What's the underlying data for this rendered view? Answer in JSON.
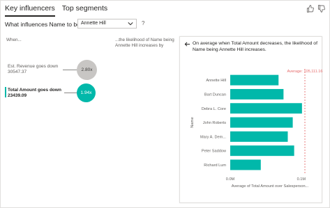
{
  "tabs": [
    {
      "label": "Key influencers",
      "active": true
    },
    {
      "label": "Top segments",
      "active": false
    }
  ],
  "question": {
    "label": "What influences Name to be",
    "selected_value": "Annette Hill",
    "help": "?"
  },
  "icons": {
    "thumbs_up": "thumbs-up-icon",
    "thumbs_down": "thumbs-down-icon",
    "back": "back-arrow-icon",
    "dropdown": "chevron-down-icon"
  },
  "headers": {
    "when": "When...",
    "likelihood": "...the likelihood of Name being Annette Hill increases by"
  },
  "influencers": [
    {
      "title": "Est. Revenue goes down",
      "value": "30547.37",
      "multiplier": "2.80x",
      "selected": false
    },
    {
      "title": "Total Amount goes down",
      "value": "23439.09",
      "multiplier": "1.94x",
      "selected": true
    }
  ],
  "panel": {
    "description": "On average when Total Amount decreases, the likelihood of Name being Annette Hill increases."
  },
  "colors": {
    "accent": "#01b8aa",
    "bubble_grey": "#c8c6c4",
    "average_line": "#e66c6c",
    "text": "#252423"
  },
  "chart_data": {
    "type": "bar",
    "orientation": "horizontal",
    "categories": [
      "Annette Hill",
      "Bart Duncan",
      "Debra L. Core",
      "John Roberts",
      "Mary A. Dem...",
      "Peter Saddow",
      "Richard Lum"
    ],
    "values": [
      68000,
      75000,
      101000,
      88000,
      81000,
      90000,
      43000
    ],
    "xlabel": "Average of Total Amount over Salesperson...",
    "ylabel": "Name",
    "xlim": [
      0,
      110000
    ],
    "x_ticks": [
      0,
      100000
    ],
    "x_tick_labels": [
      "0.0M",
      "0.1M"
    ],
    "reference_line": {
      "label": "Average: 105,111.16",
      "value": 105111.16
    },
    "bar_color": "#01b8aa"
  }
}
